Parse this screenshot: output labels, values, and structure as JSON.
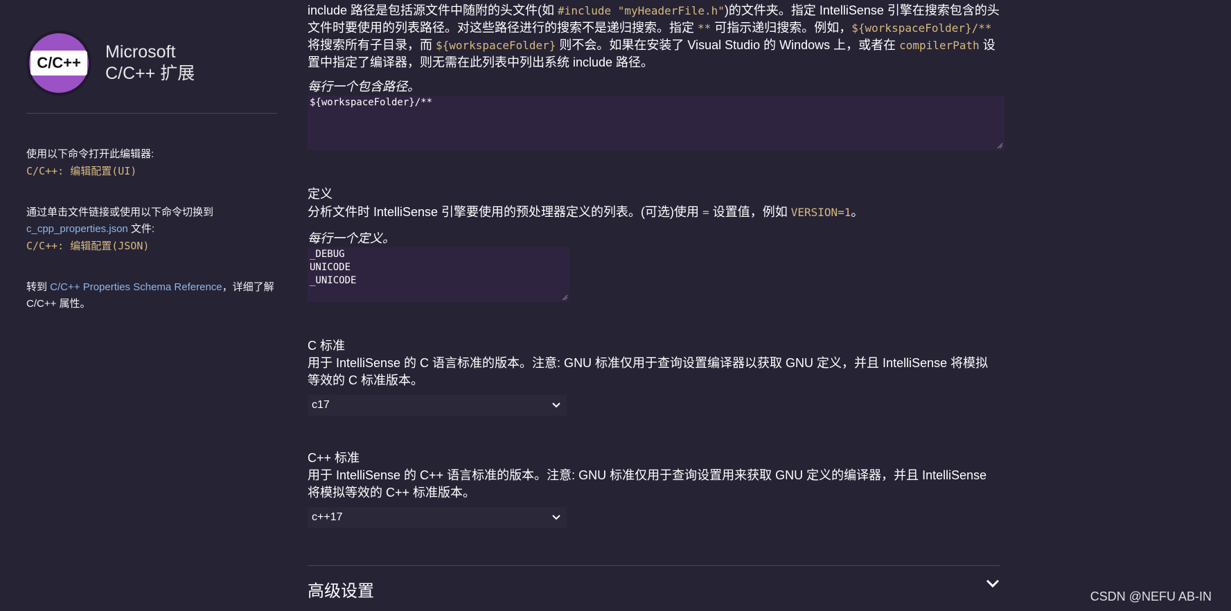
{
  "sidebar": {
    "logo_text": "C/C++",
    "brand_line1": "Microsoft",
    "brand_line2": "C/C++ 扩展",
    "open_editor_text": "使用以下命令打开此编辑器:",
    "open_editor_cmd": "C/C++: 编辑配置(UI)",
    "switch_text": "通过单击文件链接或使用以下命令切换到",
    "switch_link": "c_cpp_properties.json",
    "switch_suffix": " 文件:",
    "switch_cmd": "C/C++: 编辑配置(JSON)",
    "schema_prefix": "转到 ",
    "schema_link": "C/C++ Properties Schema Reference",
    "schema_suffix": "，详细了解 C/C++ 属性。"
  },
  "include_path": {
    "desc_p1": "include 路径是包括源文件中随附的头文件(如 ",
    "desc_code1": "#include \"myHeaderFile.h\"",
    "desc_p2": ")的文件夹。指定 IntelliSense 引擎在搜索包含的头文件时要使用的列表路径。对这些路径进行的搜索不是递归搜索。指定 ",
    "desc_code2": "**",
    "desc_p3": " 可指示递归搜索。例如，",
    "desc_code3": "${workspaceFolder}/**",
    "desc_p4": " 将搜索所有子目录，而 ",
    "desc_code4": "${workspaceFolder}",
    "desc_p5": " 则不会。如果在安装了 Visual Studio 的 Windows 上，或者在 ",
    "desc_code5": "compilerPath",
    "desc_p6": " 设置中指定了编译器，则无需在此列表中列出系统 include 路径。",
    "hint": "每行一个包含路径。",
    "value": "${workspaceFolder}/**"
  },
  "defines": {
    "title": "定义",
    "desc_p1": "分析文件时 IntelliSense 引擎要使用的预处理器定义的列表。(可选)使用 ",
    "desc_code1": "=",
    "desc_p2": " 设置值，例如 ",
    "desc_code2": "VERSION=1",
    "desc_p3": "。",
    "hint": "每行一个定义。",
    "values": [
      "_DEBUG",
      "UNICODE",
      "_UNICODE"
    ]
  },
  "c_standard": {
    "title": "C 标准",
    "desc": "用于 IntelliSense 的 C 语言标准的版本。注意: GNU 标准仅用于查询设置编译器以获取 GNU 定义，并且 IntelliSense 将模拟等效的 C 标准版本。",
    "selected": "c17"
  },
  "cpp_standard": {
    "title": "C++ 标准",
    "desc": "用于 IntelliSense 的 C++ 语言标准的版本。注意: GNU 标准仅用于查询设置用来获取 GNU 定义的编译器，并且 IntelliSense 将模拟等效的 C++ 标准版本。",
    "selected": "c++17"
  },
  "advanced": {
    "title": "高级设置"
  },
  "watermark": "CSDN @NEFU AB-IN",
  "icons": {
    "chevron": "chevron-down-icon",
    "resize": "resize-grip-icon"
  }
}
